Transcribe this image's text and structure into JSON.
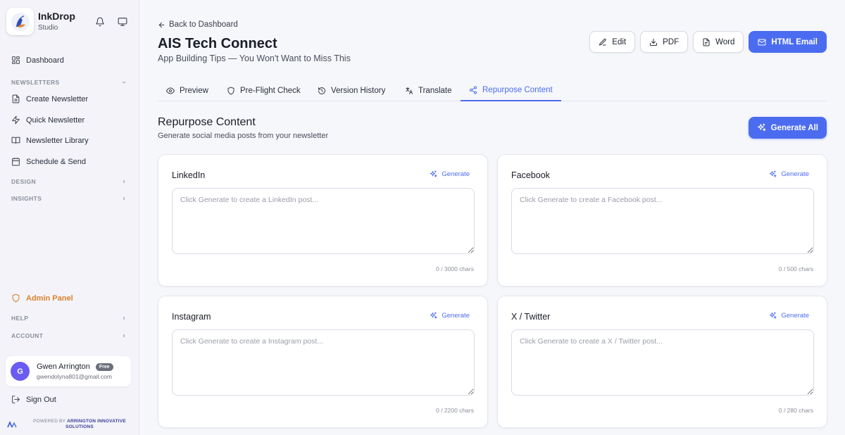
{
  "app": {
    "name": "InkDrop",
    "subtitle": "Studio"
  },
  "sidebar": {
    "dashboard": "Dashboard",
    "sections": {
      "newsletters": "NEWSLETTERS",
      "design": "DESIGN",
      "insights": "INSIGHTS",
      "help": "HELP",
      "account": "ACCOUNT"
    },
    "newsletter_items": [
      {
        "label": "Create Newsletter",
        "icon": "document-icon"
      },
      {
        "label": "Quick Newsletter",
        "icon": "bolt-icon"
      },
      {
        "label": "Newsletter Library",
        "icon": "book-icon"
      },
      {
        "label": "Schedule & Send",
        "icon": "calendar-icon"
      }
    ],
    "admin_panel": "Admin Panel",
    "user": {
      "initial": "G",
      "name": "Gwen Arrington",
      "plan": "Free",
      "email": "gwendolyna801@gmail.com"
    },
    "sign_out": "Sign Out",
    "powered_by": {
      "prefix": "POWERED BY",
      "company": "ARRINGTON INNOVATIVE SOLUTIONS"
    }
  },
  "header": {
    "back": "Back to Dashboard",
    "title": "AIS Tech Connect",
    "subtitle": "App Building Tips — You Won't Want to Miss This",
    "actions": {
      "edit": "Edit",
      "pdf": "PDF",
      "word": "Word",
      "html_email": "HTML Email"
    }
  },
  "tabs": [
    {
      "label": "Preview",
      "icon": "eye-icon"
    },
    {
      "label": "Pre-Flight Check",
      "icon": "shield-icon"
    },
    {
      "label": "Version History",
      "icon": "history-icon"
    },
    {
      "label": "Translate",
      "icon": "translate-icon"
    },
    {
      "label": "Repurpose Content",
      "icon": "share-icon",
      "active": true
    }
  ],
  "repurpose": {
    "title": "Repurpose Content",
    "subtitle": "Generate social media posts from your newsletter",
    "generate_all": "Generate All",
    "generate_label": "Generate",
    "cards": [
      {
        "platform": "LinkedIn",
        "placeholder": "Click Generate to create a LinkedIn post...",
        "count": "0 / 3000 chars"
      },
      {
        "platform": "Facebook",
        "placeholder": "Click Generate to create a Facebook post...",
        "count": "0 / 500 chars"
      },
      {
        "platform": "Instagram",
        "placeholder": "Click Generate to create a Instagram post...",
        "count": "0 / 2200 chars"
      },
      {
        "platform": "X / Twitter",
        "placeholder": "Click Generate to create a X / Twitter post...",
        "count": "0 / 280 chars"
      }
    ]
  },
  "colors": {
    "accent": "#4b6cf0",
    "admin": "#d9822b",
    "avatar": "#6a5cf2"
  }
}
